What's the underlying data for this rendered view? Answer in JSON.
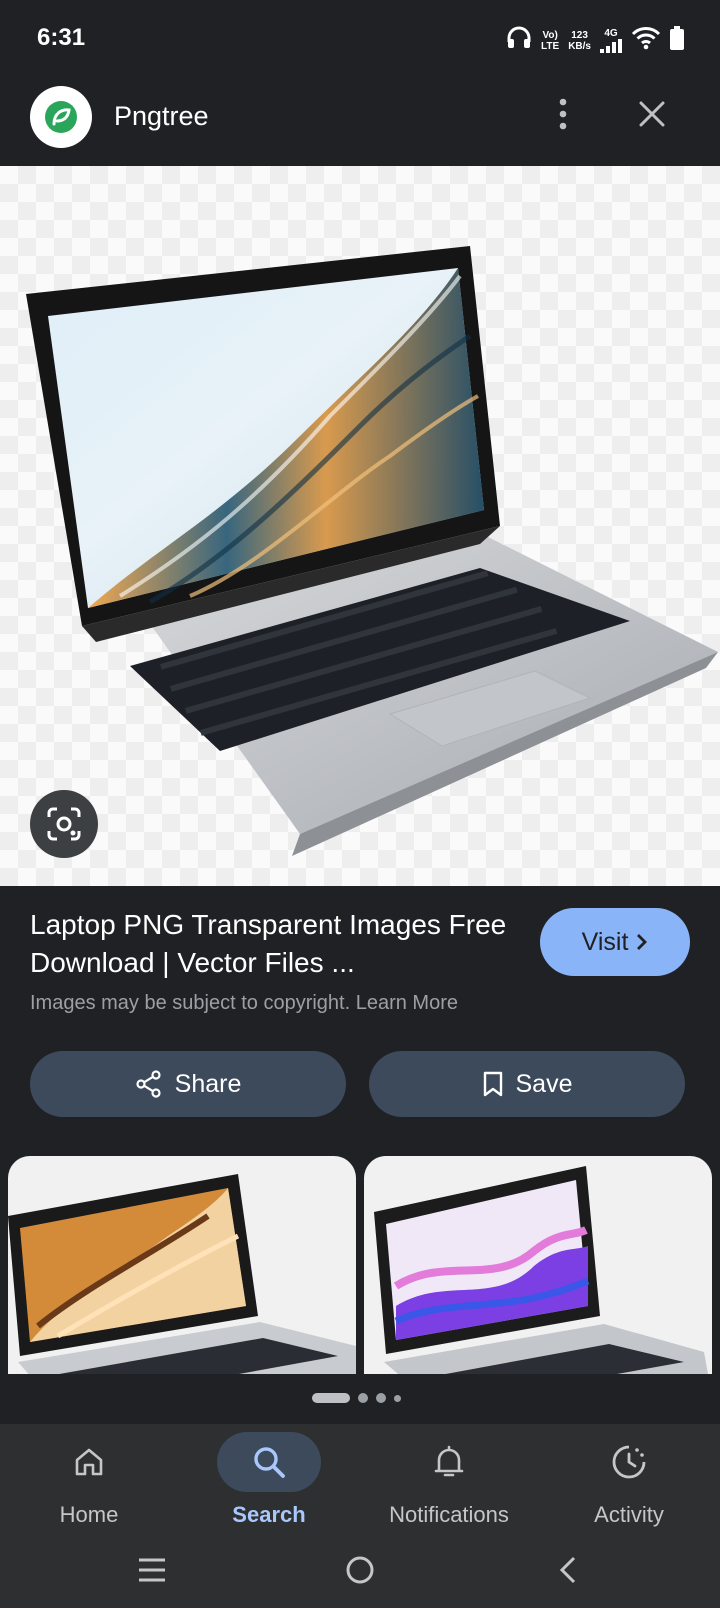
{
  "status_bar": {
    "time": "6:31",
    "volte_top": "Vo)",
    "volte_bottom": "LTE",
    "speed_value": "123",
    "speed_unit": "KB/s",
    "network": "4G"
  },
  "site": {
    "name": "Pngtree",
    "logo_icon": "pngtree-logo-icon",
    "brand_color": "#27ae60"
  },
  "result": {
    "title": "Laptop PNG Transparent Images Free Download | Vector Files ...",
    "copyright_note": "Images may be subject to copyright. Learn More",
    "visit_label": "Visit"
  },
  "actions": {
    "share_label": "Share",
    "save_label": "Save"
  },
  "carousel": {
    "pages": 4,
    "active_index": 0
  },
  "bottom_nav": {
    "items": [
      {
        "label": "Home",
        "icon": "home-icon",
        "active": false
      },
      {
        "label": "Search",
        "icon": "search-icon",
        "active": true
      },
      {
        "label": "Notifications",
        "icon": "bell-icon",
        "active": false
      },
      {
        "label": "Activity",
        "icon": "activity-icon",
        "active": false
      }
    ]
  },
  "colors": {
    "background": "#202124",
    "accent": "#8ab4f8",
    "chip": "#3c4a5c"
  }
}
